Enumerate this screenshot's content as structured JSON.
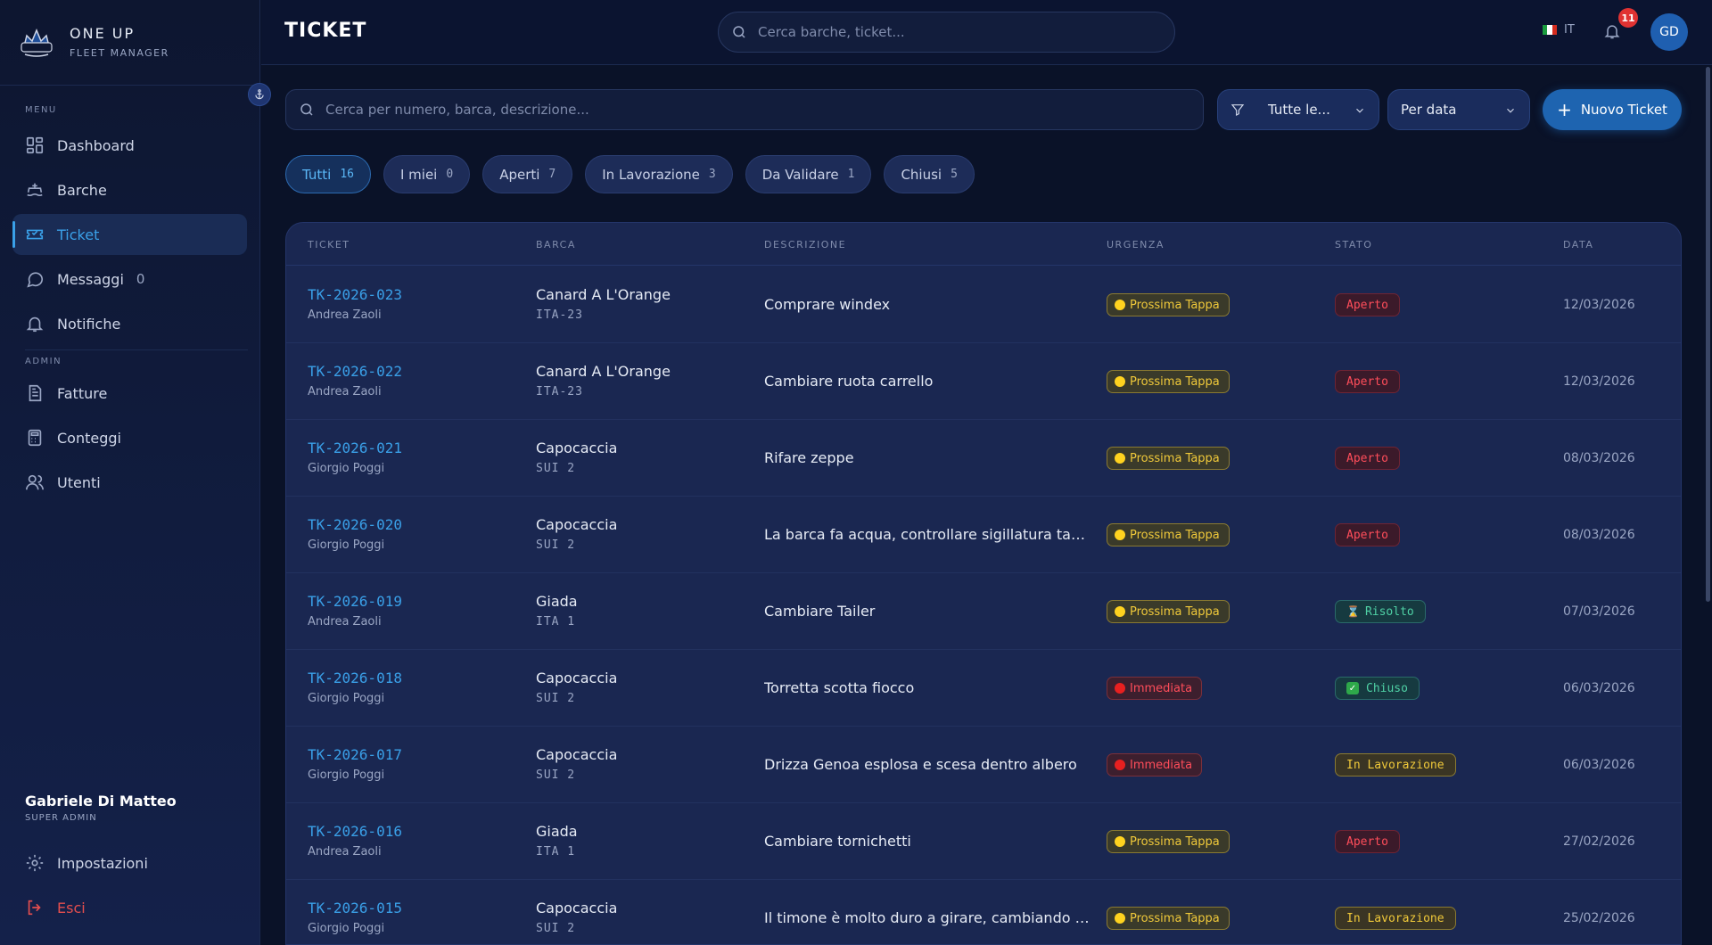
{
  "brand": {
    "name": "ONE UP",
    "subtitle": "FLEET MANAGER"
  },
  "sidebar": {
    "menu_label": "MENU",
    "admin_label": "ADMIN",
    "items": [
      {
        "label": "Dashboard",
        "icon": "dashboard-icon"
      },
      {
        "label": "Barche",
        "icon": "boat-icon"
      },
      {
        "label": "Ticket",
        "icon": "ticket-icon",
        "active": true
      },
      {
        "label": "Messaggi",
        "icon": "message-icon",
        "count": "0"
      },
      {
        "label": "Notifiche",
        "icon": "bell-icon"
      }
    ],
    "admin_items": [
      {
        "label": "Fatture",
        "icon": "invoice-icon"
      },
      {
        "label": "Conteggi",
        "icon": "calculator-icon"
      },
      {
        "label": "Utenti",
        "icon": "users-icon"
      }
    ],
    "user": {
      "name": "Gabriele Di Matteo",
      "role": "SUPER ADMIN"
    },
    "settings_label": "Impostazioni",
    "logout_label": "Esci"
  },
  "header": {
    "title": "TICKET",
    "search_placeholder": "Cerca barche, ticket...",
    "language": "IT",
    "notifications_count": "11",
    "avatar_initials": "GD"
  },
  "toolbar": {
    "search_placeholder": "Cerca per numero, barca, descrizione...",
    "status_filter": "Tutte le...",
    "sort": "Per data",
    "new_button": "Nuovo Ticket"
  },
  "tabs": [
    {
      "label": "Tutti",
      "count": "16",
      "active": true
    },
    {
      "label": "I miei",
      "count": "0"
    },
    {
      "label": "Aperti",
      "count": "7"
    },
    {
      "label": "In Lavorazione",
      "count": "3"
    },
    {
      "label": "Da Validare",
      "count": "1"
    },
    {
      "label": "Chiusi",
      "count": "5"
    }
  ],
  "table": {
    "columns": [
      "TICKET",
      "BARCA",
      "DESCRIZIONE",
      "URGENZA",
      "STATO",
      "DATA"
    ],
    "rows": [
      {
        "id": "TK-2026-023",
        "user": "Andrea Zaoli",
        "boat": "Canard A L'Orange",
        "sail": "ITA-23",
        "description": "Comprare windex",
        "urgency": "Prossima Tappa",
        "status": "Aperto",
        "date": "12/03/2026"
      },
      {
        "id": "TK-2026-022",
        "user": "Andrea Zaoli",
        "boat": "Canard A L'Orange",
        "sail": "ITA-23",
        "description": "Cambiare ruota carrello",
        "urgency": "Prossima Tappa",
        "status": "Aperto",
        "date": "12/03/2026"
      },
      {
        "id": "TK-2026-021",
        "user": "Giorgio Poggi",
        "boat": "Capocaccia",
        "sail": "SUI 2",
        "description": "Rifare zeppe",
        "urgency": "Prossima Tappa",
        "status": "Aperto",
        "date": "08/03/2026"
      },
      {
        "id": "TK-2026-020",
        "user": "Giorgio Poggi",
        "boat": "Capocaccia",
        "sail": "SUI 2",
        "description": "La barca fa acqua, controllare sigillatura tappo d...",
        "urgency": "Prossima Tappa",
        "status": "Aperto",
        "date": "08/03/2026"
      },
      {
        "id": "TK-2026-019",
        "user": "Andrea Zaoli",
        "boat": "Giada",
        "sail": "ITA 1",
        "description": "Cambiare Tailer",
        "urgency": "Prossima Tappa",
        "status": "Risolto",
        "date": "07/03/2026"
      },
      {
        "id": "TK-2026-018",
        "user": "Giorgio Poggi",
        "boat": "Capocaccia",
        "sail": "SUI 2",
        "description": "Torretta scotta fiocco",
        "urgency": "Immediata",
        "status": "Chiuso",
        "date": "06/03/2026"
      },
      {
        "id": "TK-2026-017",
        "user": "Giorgio Poggi",
        "boat": "Capocaccia",
        "sail": "SUI 2",
        "description": "Drizza Genoa esplosa e scesa dentro albero",
        "urgency": "Immediata",
        "status": "In Lavorazione",
        "date": "06/03/2026"
      },
      {
        "id": "TK-2026-016",
        "user": "Andrea Zaoli",
        "boat": "Giada",
        "sail": "ITA 1",
        "description": "Cambiare tornichetti",
        "urgency": "Prossima Tappa",
        "status": "Aperto",
        "date": "27/02/2026"
      },
      {
        "id": "TK-2026-015",
        "user": "Giorgio Poggi",
        "boat": "Capocaccia",
        "sail": "SUI 2",
        "description": "Il timone è molto duro a girare, cambiando le bo...",
        "urgency": "Prossima Tappa",
        "status": "In Lavorazione",
        "date": "25/02/2026"
      }
    ]
  },
  "colors": {
    "accent": "#3aa0e8",
    "background": "#0a1228",
    "panel": "#1a2751",
    "danger": "#ff4d5a",
    "warning": "#f0c93a",
    "success": "#4fd1a5"
  }
}
